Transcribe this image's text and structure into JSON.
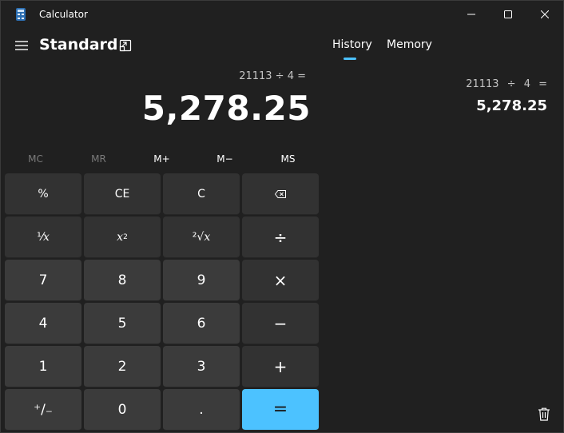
{
  "window": {
    "title": "Calculator",
    "icon": "calculator-app-icon",
    "controls": [
      "minimize-icon",
      "maximize-icon",
      "close-icon"
    ]
  },
  "header": {
    "mode": "Standard",
    "menu_icon": "hamburger-menu-icon",
    "keep_on_top_icon": "keep-on-top-icon"
  },
  "display": {
    "expression": "21113 ÷ 4 =",
    "result": "5,278.25"
  },
  "memory": {
    "buttons": [
      {
        "label": "MC",
        "enabled": false
      },
      {
        "label": "MR",
        "enabled": false
      },
      {
        "label": "M+",
        "enabled": true
      },
      {
        "label": "M−",
        "enabled": true
      },
      {
        "label": "MS",
        "enabled": true
      }
    ]
  },
  "keypad": {
    "percent": "%",
    "ce": "CE",
    "c": "C",
    "backspace_icon": "backspace-icon",
    "reciprocal": "⅟",
    "reciprocal_var": "x",
    "square_var": "x",
    "square_exp": "2",
    "sqrt_root": "²√",
    "sqrt_var": "x",
    "divide": "÷",
    "multiply": "×",
    "subtract": "−",
    "add": "+",
    "negate": "⁺/₋",
    "decimal": ".",
    "equals": "=",
    "d7": "7",
    "d8": "8",
    "d9": "9",
    "d4": "4",
    "d5": "5",
    "d6": "6",
    "d1": "1",
    "d2": "2",
    "d3": "3",
    "d0": "0"
  },
  "panel": {
    "tabs": [
      "History",
      "Memory"
    ],
    "active_tab": "History",
    "history": [
      {
        "expression": "21113 ÷ 4 =",
        "result": "5,278.25"
      }
    ],
    "clear_icon": "trash-icon"
  },
  "colors": {
    "background": "#202020",
    "key_number": "#3b3b3b",
    "key_function": "#323232",
    "accent": "#4cc2ff"
  }
}
